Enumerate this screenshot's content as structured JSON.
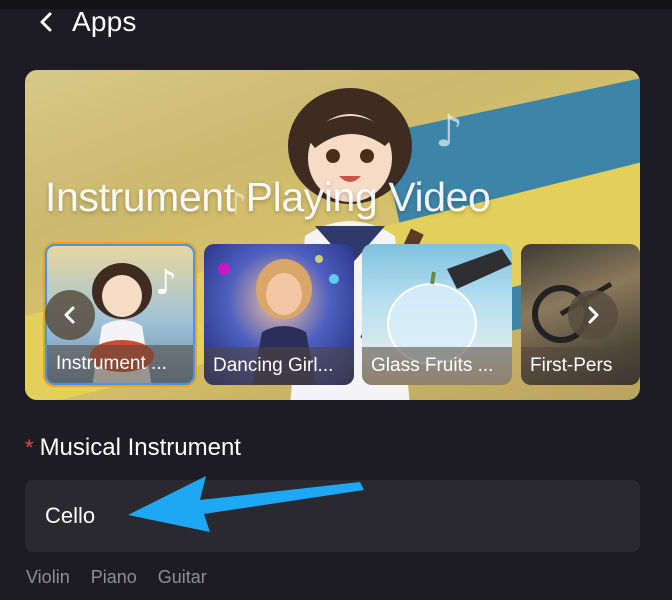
{
  "header": {
    "title": "Apps"
  },
  "banner": {
    "title": "Instrument Playing Video",
    "cards": [
      {
        "label": "Instrument ..."
      },
      {
        "label": "Dancing Girl..."
      },
      {
        "label": "Glass Fruits ..."
      },
      {
        "label": "First-Pers"
      }
    ]
  },
  "form": {
    "label": "Musical Instrument",
    "required_mark": "*",
    "value": "Cello",
    "suggestions": [
      "Violin",
      "Piano",
      "Guitar"
    ]
  },
  "colors": {
    "background": "#1c1c22",
    "input_bg": "#29292f",
    "required": "#e64a3c",
    "annotation_arrow": "#1ea7f5"
  }
}
